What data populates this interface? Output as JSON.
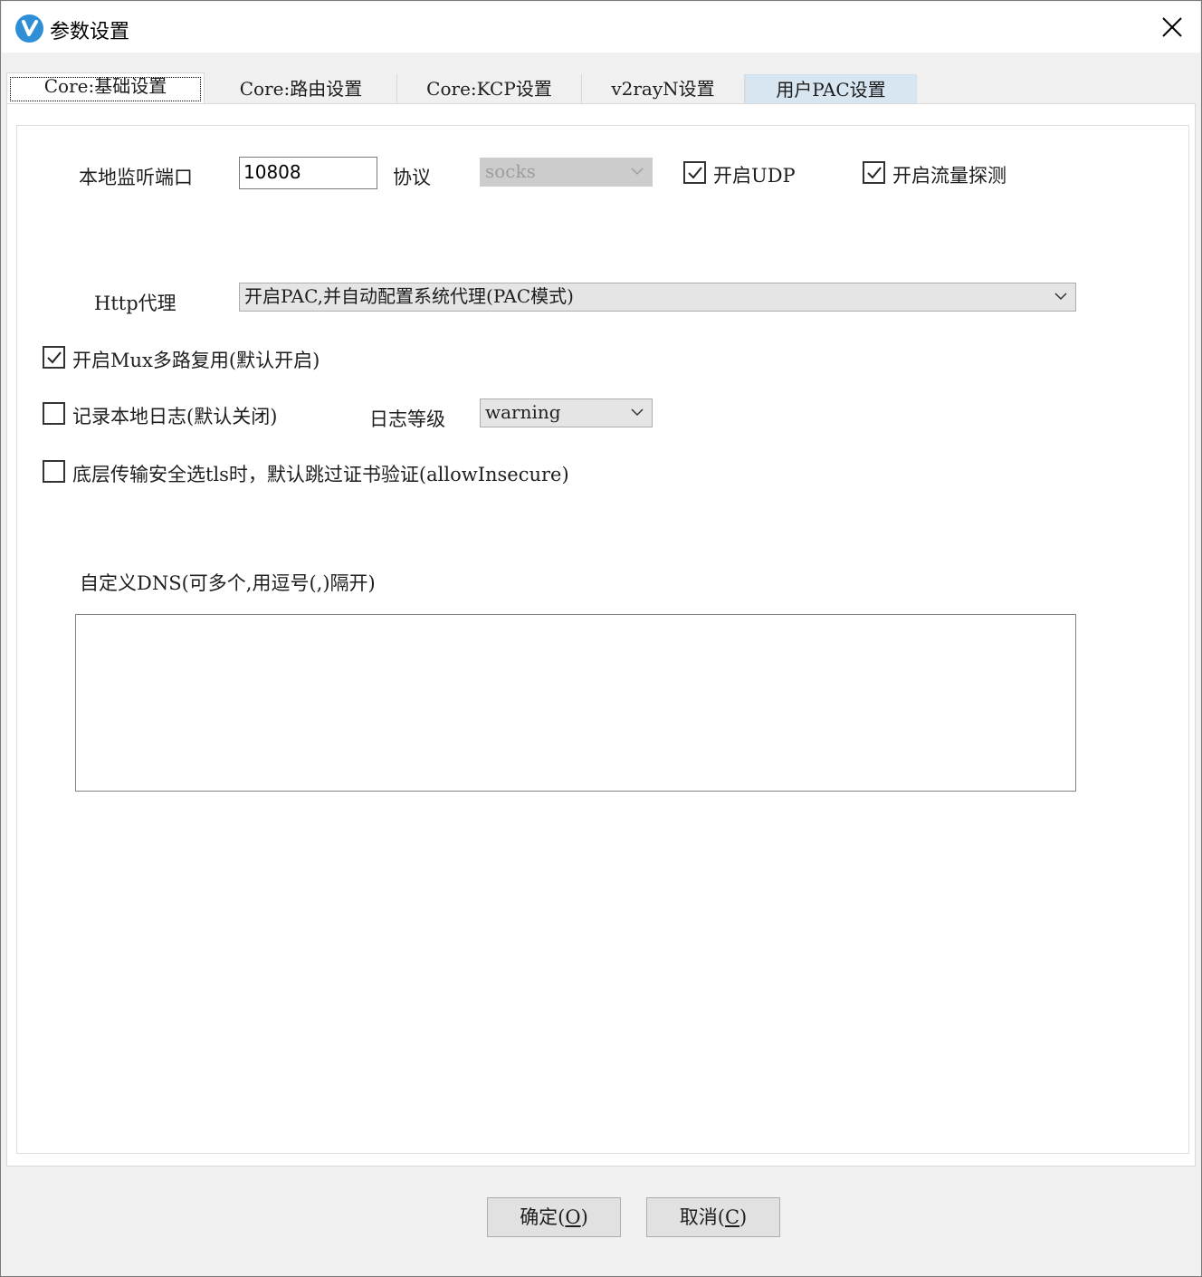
{
  "window": {
    "title": "参数设置",
    "icon": "v2rayn-logo-icon",
    "close_icon": "close-icon"
  },
  "tabs": [
    {
      "label": "Core:基础设置",
      "state": "selected"
    },
    {
      "label": "Core:路由设置"
    },
    {
      "label": "Core:KCP设置"
    },
    {
      "label": "v2rayN设置"
    },
    {
      "label": "用户PAC设置",
      "state": "hover"
    }
  ],
  "basic": {
    "local_port_label": "本地监听端口",
    "local_port_value": "10808",
    "protocol_label": "协议",
    "protocol_value": "socks",
    "udp_label": "开启UDP",
    "udp_checked": true,
    "sniffing_label": "开启流量探测",
    "sniffing_checked": true,
    "http_proxy_label": "Http代理",
    "http_proxy_value": "开启PAC,并自动配置系统代理(PAC模式)",
    "mux_label": "开启Mux多路复用(默认开启)",
    "mux_checked": true,
    "log_label": "记录本地日志(默认关闭)",
    "log_checked": false,
    "log_level_label": "日志等级",
    "log_level_value": "warning",
    "allow_insecure_label": "底层传输安全选tls时，默认跳过证书验证(allowInsecure)",
    "allow_insecure_checked": false,
    "dns_label": "自定义DNS(可多个,用逗号(,)隔开)",
    "dns_value": ""
  },
  "buttons": {
    "ok_text": "确定(",
    "ok_key": "O",
    "ok_close": ")",
    "cancel_text": "取消(",
    "cancel_key": "C",
    "cancel_close": ")"
  },
  "colors": {
    "app_icon": "#2f8fd6",
    "tab_hover": "#d8e6f2",
    "dialog_bg": "#f0f0f0"
  }
}
